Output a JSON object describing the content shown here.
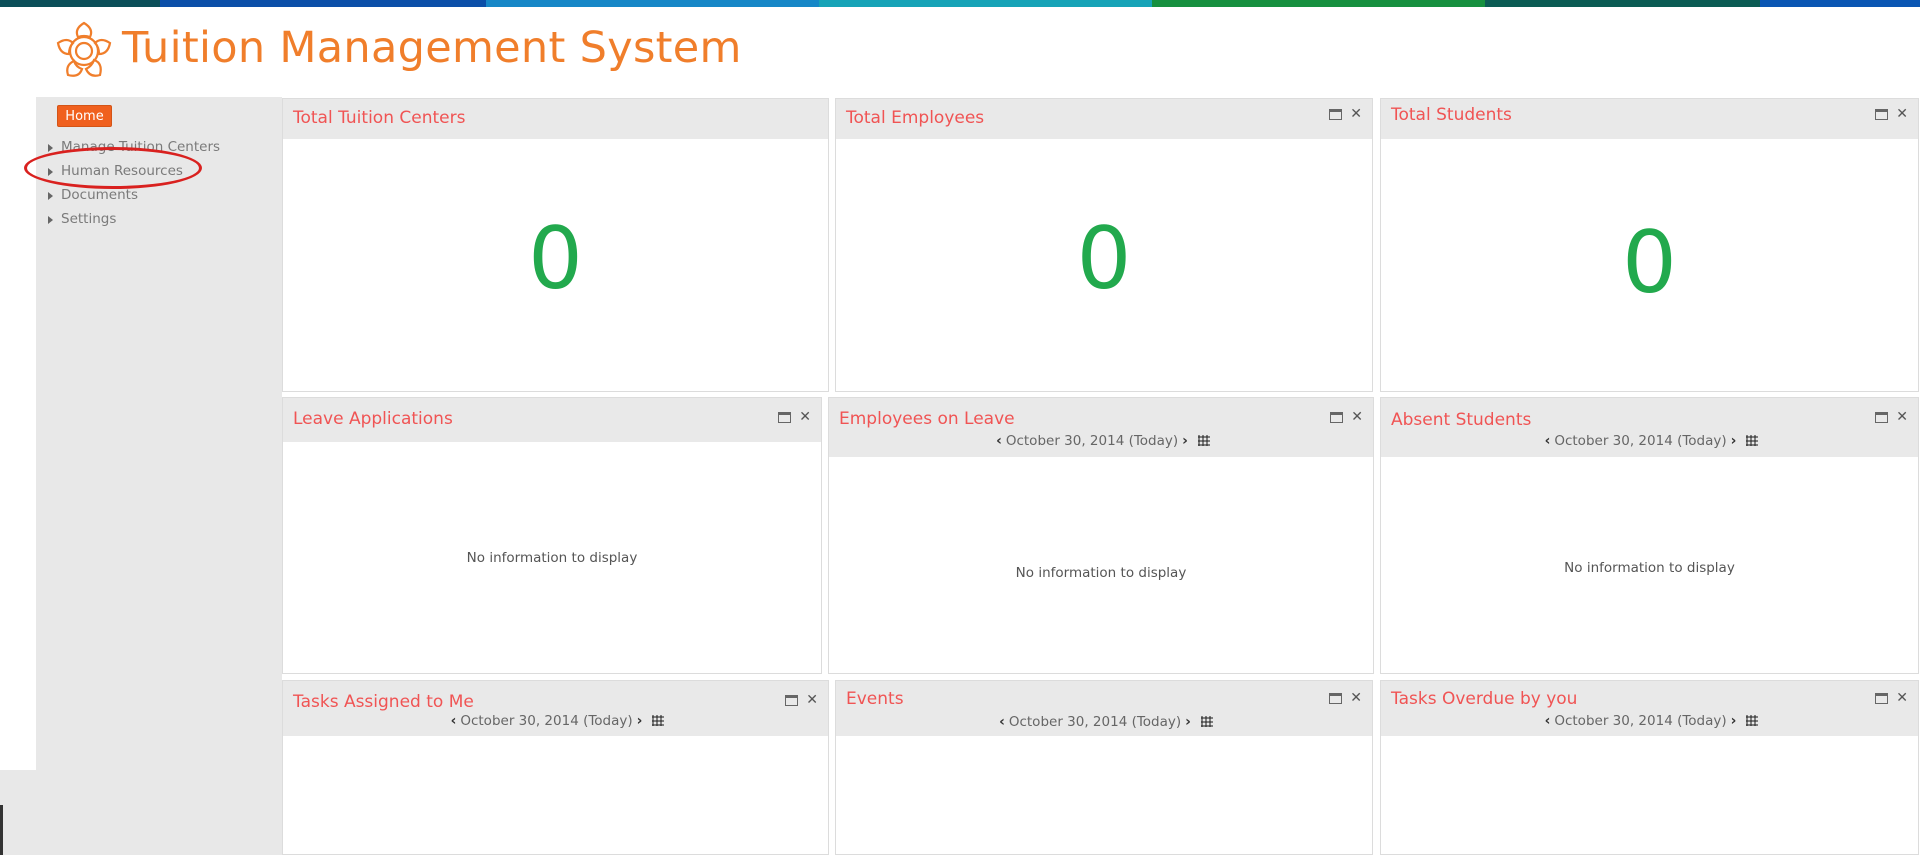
{
  "header": {
    "title": "Tuition Management System"
  },
  "brand_colors": {
    "accent": "#f07e2b",
    "home_button": "#f0601e",
    "widget_title": "#f05454",
    "count": "#22a94d"
  },
  "top_strip_colors": [
    "#0b4f59",
    "#0b4fa8",
    "#1687c7",
    "#17a3b7",
    "#16903f",
    "#0b5c54",
    "#0a56b3"
  ],
  "sidebar": {
    "home_label": "Home",
    "items": [
      {
        "label": "Manage Tuition Centers"
      },
      {
        "label": "Human Resources"
      },
      {
        "label": "Documents"
      },
      {
        "label": "Settings"
      }
    ]
  },
  "widgets": {
    "total_tuition_centers": {
      "title": "Total Tuition Centers",
      "count": "0"
    },
    "total_employees": {
      "title": "Total Employees",
      "count": "0"
    },
    "total_students": {
      "title": "Total Students",
      "count": "0"
    },
    "leave_applications": {
      "title": "Leave Applications",
      "empty_text": "No information to display"
    },
    "employees_on_leave": {
      "title": "Employees on Leave",
      "date": "October 30, 2014 (Today)",
      "empty_text": "No information to display"
    },
    "absent_students": {
      "title": "Absent Students",
      "date": "October 30, 2014 (Today)",
      "empty_text": "No information to display"
    },
    "tasks_assigned": {
      "title": "Tasks Assigned to Me",
      "date": "October 30, 2014 (Today)"
    },
    "events": {
      "title": "Events",
      "date": "October 30, 2014 (Today)"
    },
    "tasks_overdue": {
      "title": "Tasks Overdue by you",
      "date": "October 30, 2014 (Today)"
    }
  }
}
